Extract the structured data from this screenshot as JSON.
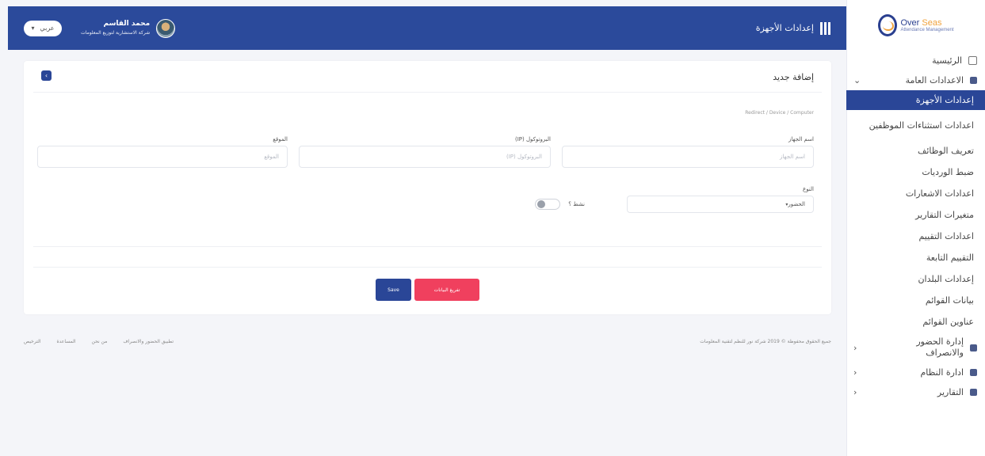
{
  "brand": {
    "logo_title_part1": "Over",
    "logo_title_part2": "Seas",
    "logo_subtitle": "Attendance Management"
  },
  "topbar": {
    "page_title": "إعدادات الأجهزة",
    "user_name": "محمد القاسم",
    "user_role": "شركة الاستشارية لتوزيع المعلومات",
    "language_label": "عربي"
  },
  "sidebar": {
    "home_label": "الرئيسية",
    "general_settings_label": "الاعدادات العامة",
    "sub_items": [
      "إعدادات الأجهزة",
      "اعدادات استثناءات الموظفين",
      "تعريف الوظائف",
      "ضبط الورديات",
      "اعدادات الاشعارات",
      "متغيرات التقارير",
      "اعدادات التقييم",
      "التقييم التابعة",
      "إعدادات البلدان",
      "بيانات القوائم",
      "عناوين القوائم"
    ],
    "attendance_label": "إدارة الحضور والانصراف",
    "system_label": "ادارة النظام",
    "reports_label": "التقارير"
  },
  "form": {
    "title": "إضافة جديد",
    "section_hint": "Redirect / Device / Computer",
    "device_name_label": "اسم الجهاز",
    "device_name_placeholder": "اسم الجهاز",
    "ip_label": "البروتوكول (IP)",
    "ip_placeholder": "البروتوكول (IP)",
    "location_label": "الموقع",
    "location_placeholder": "الموقع",
    "type_label": "النوع",
    "type_value": "الحضور",
    "active_label": "نشط ؟",
    "active_on": false,
    "clear_button": "تفريغ البيانات",
    "save_button": "Save"
  },
  "footer": {
    "copyright": "جميع الحقوق محفوظة © 2019 شركة نور للنظم لتقنية المعلومات",
    "links": [
      "تطبيق الحضور والانصراف",
      "من نحن",
      "المساعدة",
      "الترخيص"
    ]
  }
}
